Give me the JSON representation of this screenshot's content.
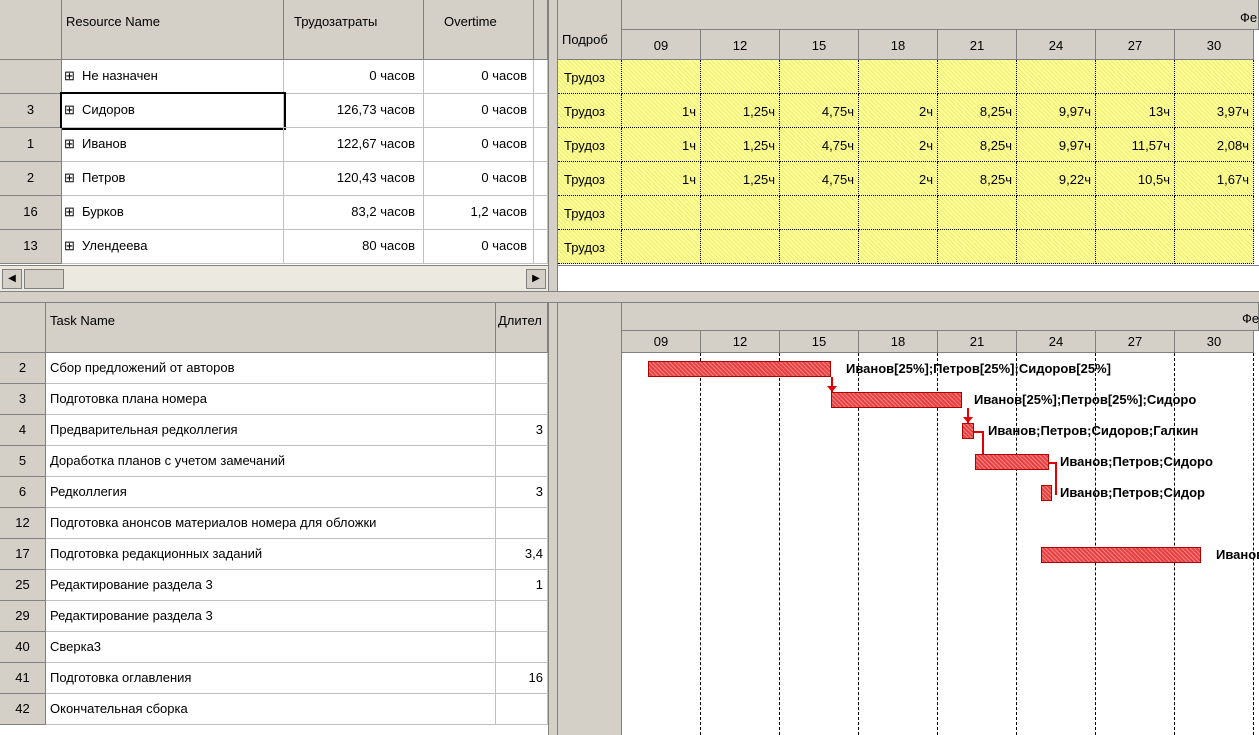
{
  "resource_table": {
    "headers": {
      "name": "Resource Name",
      "work": "Трудозатраты",
      "overtime": "Overtime"
    },
    "rows": [
      {
        "id": "",
        "name": "Не назначен",
        "work": "0 часов",
        "overtime": "0 часов"
      },
      {
        "id": "3",
        "name": "Сидоров",
        "work": "126,73 часов",
        "overtime": "0 часов"
      },
      {
        "id": "1",
        "name": "Иванов",
        "work": "122,67 часов",
        "overtime": "0 часов"
      },
      {
        "id": "2",
        "name": "Петров",
        "work": "120,43 часов",
        "overtime": "0 часов"
      },
      {
        "id": "16",
        "name": "Бурков",
        "work": "83,2 часов",
        "overtime": "1,2 часов"
      },
      {
        "id": "13",
        "name": "Улендеева",
        "work": "80 часов",
        "overtime": "0 часов"
      }
    ],
    "expand_glyph": "⊞"
  },
  "usage_grid": {
    "details_header": "Подроб",
    "month_label": "Фе",
    "dates": [
      "09",
      "12",
      "15",
      "18",
      "21",
      "24",
      "27",
      "30"
    ],
    "row_label": "Трудоз",
    "rows": [
      [
        "",
        "",
        "",
        "",
        "",
        "",
        "",
        ""
      ],
      [
        "1ч",
        "1,25ч",
        "4,75ч",
        "2ч",
        "8,25ч",
        "9,97ч",
        "13ч",
        "3,97ч"
      ],
      [
        "1ч",
        "1,25ч",
        "4,75ч",
        "2ч",
        "8,25ч",
        "9,97ч",
        "11,57ч",
        "2,08ч"
      ],
      [
        "1ч",
        "1,25ч",
        "4,75ч",
        "2ч",
        "8,25ч",
        "9,22ч",
        "10,5ч",
        "1,67ч"
      ],
      [
        "",
        "",
        "",
        "",
        "",
        "",
        "",
        ""
      ],
      [
        "",
        "",
        "",
        "",
        "",
        "",
        "",
        ""
      ]
    ]
  },
  "task_table": {
    "headers": {
      "name": "Task Name",
      "duration": "Длител"
    },
    "rows": [
      {
        "id": "2",
        "name": "Сбор предложений от авторов",
        "duration": ""
      },
      {
        "id": "3",
        "name": "Подготовка плана номера",
        "duration": ""
      },
      {
        "id": "4",
        "name": "Предварительная редколлегия",
        "duration": "3"
      },
      {
        "id": "5",
        "name": "Доработка планов с учетом замечаний",
        "duration": ""
      },
      {
        "id": "6",
        "name": "Редколлегия",
        "duration": "3"
      },
      {
        "id": "12",
        "name": "Подготовка анонсов материалов номера для обложки",
        "duration": ""
      },
      {
        "id": "17",
        "name": "Подготовка редакционных заданий",
        "duration": "3,4"
      },
      {
        "id": "25",
        "name": "Редактирование раздела 3",
        "duration": "1"
      },
      {
        "id": "29",
        "name": "Редактирование раздела 3",
        "duration": ""
      },
      {
        "id": "40",
        "name": "Сверка3",
        "duration": ""
      },
      {
        "id": "41",
        "name": "Подготовка оглавления",
        "duration": "16"
      },
      {
        "id": "42",
        "name": "Окончательная сборка",
        "duration": ""
      }
    ]
  },
  "gantt": {
    "month_label": "Фе",
    "dates": [
      "09",
      "12",
      "15",
      "18",
      "21",
      "24",
      "27",
      "30"
    ],
    "bar_color": "#e84040",
    "labels": [
      "Иванов[25%];Петров[25%];Сидоров[25%]",
      "Иванов[25%];Петров[25%];Сидоро",
      "Иванов;Петров;Сидоров;Галкин",
      "Иванов;Петров;Сидоро",
      "Иванов;Петров;Сидор",
      "Иванов"
    ]
  },
  "scroll": {
    "left_arrow": "◀",
    "right_arrow": "▶"
  }
}
